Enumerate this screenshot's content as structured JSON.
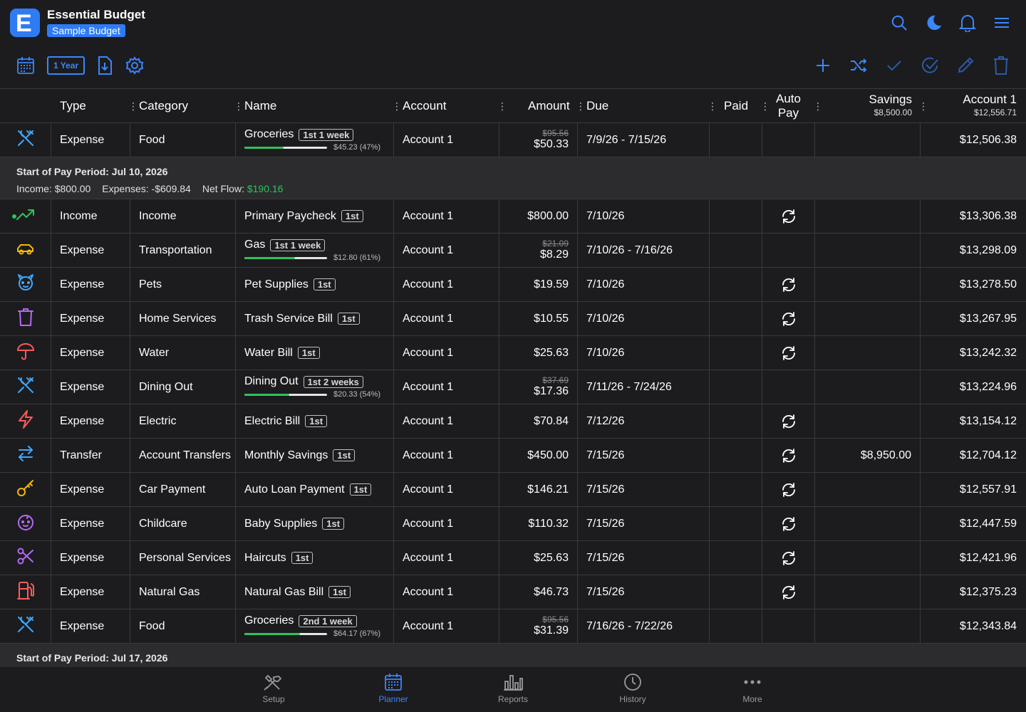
{
  "app": {
    "title": "Essential Budget",
    "budget_name": "Sample Budget",
    "logo_letter": "E"
  },
  "toolbar": {
    "year_label": "1 Year"
  },
  "columns": {
    "type": "Type",
    "category": "Category",
    "name": "Name",
    "account": "Account",
    "amount": "Amount",
    "due": "Due",
    "paid": "Paid",
    "auto_pay_1": "Auto",
    "auto_pay_2": "Pay",
    "savings": "Savings",
    "savings_total": "$8,500.00",
    "account1": "Account 1",
    "account1_total": "$12,556.71"
  },
  "rows": [
    {
      "icon": "utensils-icon",
      "icon_color": "#3da8ff",
      "type": "Expense",
      "category": "Food",
      "name": "Groceries",
      "tag": "1st 1 week",
      "progress": 0.47,
      "progress_text": "$45.23 (47%)",
      "account": "Account 1",
      "amount_old": "$95.56",
      "amount": "$50.33",
      "due": "7/9/26 - 7/15/26",
      "autopay": false,
      "savings": "",
      "balance": "$12,506.38"
    },
    {
      "period": true,
      "title": "Start of Pay Period: Jul 10, 2026",
      "income": "Income: $800.00",
      "expenses": "Expenses: -$609.84",
      "netflow_label": "Net Flow: ",
      "netflow": "$190.16"
    },
    {
      "icon": "trending-up-icon",
      "icon_color": "#2fc25b",
      "dot": true,
      "type": "Income",
      "category": "Income",
      "name": "Primary Paycheck",
      "tag": "1st",
      "account": "Account 1",
      "amount": "$800.00",
      "due": "7/10/26",
      "autopay": true,
      "savings": "",
      "balance": "$13,306.38"
    },
    {
      "icon": "car-icon",
      "icon_color": "#f5b800",
      "type": "Expense",
      "category": "Transportation",
      "name": "Gas",
      "tag": "1st 1 week",
      "progress": 0.61,
      "progress_text": "$12.80 (61%)",
      "account": "Account 1",
      "amount_old": "$21.09",
      "amount": "$8.29",
      "due": "7/10/26 - 7/16/26",
      "autopay": false,
      "savings": "",
      "balance": "$13,298.09"
    },
    {
      "icon": "paw-icon",
      "icon_color": "#3da8ff",
      "type": "Expense",
      "category": "Pets",
      "name": "Pet Supplies",
      "tag": "1st",
      "account": "Account 1",
      "amount": "$19.59",
      "due": "7/10/26",
      "autopay": true,
      "savings": "",
      "balance": "$13,278.50"
    },
    {
      "icon": "trash-icon",
      "icon_color": "#b668f5",
      "type": "Expense",
      "category": "Home Services",
      "name": "Trash Service Bill",
      "tag": "1st",
      "account": "Account 1",
      "amount": "$10.55",
      "due": "7/10/26",
      "autopay": true,
      "savings": "",
      "balance": "$13,267.95"
    },
    {
      "icon": "umbrella-icon",
      "icon_color": "#ff5a5a",
      "type": "Expense",
      "category": "Water",
      "name": "Water Bill",
      "tag": "1st",
      "account": "Account 1",
      "amount": "$25.63",
      "due": "7/10/26",
      "autopay": true,
      "savings": "",
      "balance": "$13,242.32"
    },
    {
      "icon": "utensils-icon",
      "icon_color": "#3da8ff",
      "type": "Expense",
      "category": "Dining Out",
      "name": "Dining Out",
      "tag": "1st 2 weeks",
      "progress": 0.54,
      "progress_text": "$20.33 (54%)",
      "account": "Account 1",
      "amount_old": "$37.69",
      "amount": "$17.36",
      "due": "7/11/26 - 7/24/26",
      "autopay": false,
      "savings": "",
      "balance": "$13,224.96"
    },
    {
      "icon": "bolt-icon",
      "icon_color": "#ff5a5a",
      "type": "Expense",
      "category": "Electric",
      "name": "Electric Bill",
      "tag": "1st",
      "account": "Account 1",
      "amount": "$70.84",
      "due": "7/12/26",
      "autopay": true,
      "savings": "",
      "balance": "$13,154.12"
    },
    {
      "icon": "transfer-icon",
      "icon_color": "#3da8ff",
      "type": "Transfer",
      "category": "Account Transfers",
      "name": "Monthly Savings",
      "tag": "1st",
      "account": "Account 1",
      "amount": "$450.00",
      "due": "7/15/26",
      "autopay": true,
      "savings": "$8,950.00",
      "balance": "$12,704.12"
    },
    {
      "icon": "key-icon",
      "icon_color": "#f5b800",
      "type": "Expense",
      "category": "Car Payment",
      "name": "Auto Loan Payment",
      "tag": "1st",
      "account": "Account 1",
      "amount": "$146.21",
      "due": "7/15/26",
      "autopay": true,
      "savings": "",
      "balance": "$12,557.91"
    },
    {
      "icon": "baby-icon",
      "icon_color": "#b668f5",
      "type": "Expense",
      "category": "Childcare",
      "name": "Baby Supplies",
      "tag": "1st",
      "account": "Account 1",
      "amount": "$110.32",
      "due": "7/15/26",
      "autopay": true,
      "savings": "",
      "balance": "$12,447.59"
    },
    {
      "icon": "scissors-icon",
      "icon_color": "#b668f5",
      "type": "Expense",
      "category": "Personal Services",
      "name": "Haircuts",
      "tag": "1st",
      "account": "Account 1",
      "amount": "$25.63",
      "due": "7/15/26",
      "autopay": true,
      "savings": "",
      "balance": "$12,421.96"
    },
    {
      "icon": "gas-pump-icon",
      "icon_color": "#ff5a5a",
      "type": "Expense",
      "category": "Natural Gas",
      "name": "Natural Gas Bill",
      "tag": "1st",
      "account": "Account 1",
      "amount": "$46.73",
      "due": "7/15/26",
      "autopay": true,
      "savings": "",
      "balance": "$12,375.23"
    },
    {
      "icon": "utensils-icon",
      "icon_color": "#3da8ff",
      "type": "Expense",
      "category": "Food",
      "name": "Groceries",
      "tag": "2nd 1 week",
      "progress": 0.67,
      "progress_text": "$64.17 (67%)",
      "account": "Account 1",
      "amount_old": "$95.56",
      "amount": "$31.39",
      "due": "7/16/26 - 7/22/26",
      "autopay": false,
      "savings": "",
      "balance": "$12,343.84"
    },
    {
      "period": true,
      "short": true,
      "title": "Start of Pay Period: Jul 17, 2026"
    }
  ],
  "nav": [
    {
      "id": "setup",
      "label": "Setup",
      "icon": "tools-icon",
      "active": false
    },
    {
      "id": "planner",
      "label": "Planner",
      "icon": "calendar-icon",
      "active": true
    },
    {
      "id": "reports",
      "label": "Reports",
      "icon": "bar-chart-icon",
      "active": false
    },
    {
      "id": "history",
      "label": "History",
      "icon": "clock-icon",
      "active": false
    },
    {
      "id": "more",
      "label": "More",
      "icon": "more-icon",
      "active": false
    }
  ],
  "colors": {
    "accent": "#3b86ff",
    "green": "#2fc25b",
    "background": "#1c1c1e",
    "period_bg": "#2c2c2e"
  }
}
